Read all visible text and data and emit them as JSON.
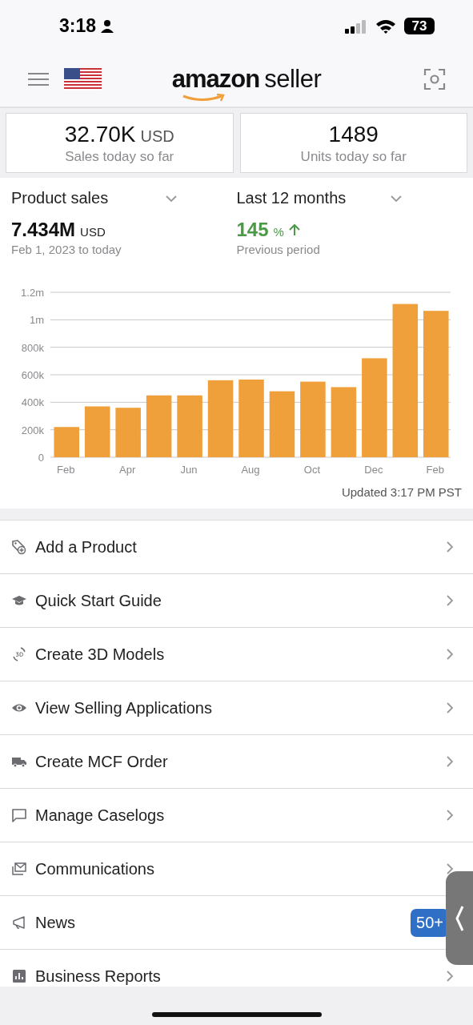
{
  "status_bar": {
    "time": "3:18",
    "battery": "73"
  },
  "header": {
    "logo": {
      "brand": "amazon",
      "product": "seller"
    }
  },
  "stats": [
    {
      "value": "32.70K",
      "unit": "USD",
      "label": "Sales today so far"
    },
    {
      "value": "1489",
      "label": "Units today so far"
    }
  ],
  "selectors": [
    {
      "label": "Product sales"
    },
    {
      "label": "Last 12 months"
    }
  ],
  "total": {
    "value": "7.434M",
    "unit": "USD",
    "caption": "Feb 1, 2023 to today"
  },
  "change": {
    "value": "145",
    "unit": "%",
    "caption": "Previous period"
  },
  "chart_data": {
    "type": "bar",
    "grid": true,
    "categories": [
      "Feb",
      null,
      "Apr",
      null,
      "Jun",
      null,
      "Aug",
      null,
      "Oct",
      null,
      "Dec",
      null,
      "Feb"
    ],
    "series": [
      {
        "color": "#f0a03a",
        "values": [
          220000,
          370000,
          360000,
          450000,
          450000,
          560000,
          565000,
          480000,
          550000,
          510000,
          720000,
          1115000,
          1065000
        ]
      }
    ],
    "ylim": [
      0,
      1200000
    ],
    "yticks": [
      {
        "value": 0,
        "label": "0"
      },
      {
        "value": 200000,
        "label": "200k"
      },
      {
        "value": 400000,
        "label": "400k"
      },
      {
        "value": 600000,
        "label": "600k"
      },
      {
        "value": 800000,
        "label": "800k"
      },
      {
        "value": 1000000,
        "label": "1m"
      },
      {
        "value": 1200000,
        "label": "1.2m"
      }
    ]
  },
  "updated": "Updated 3:17 PM PST",
  "menu": [
    {
      "label": "Add a Product"
    },
    {
      "label": "Quick Start Guide"
    },
    {
      "label": "Create 3D Models"
    },
    {
      "label": "View Selling Applications"
    },
    {
      "label": "Create MCF Order"
    },
    {
      "label": "Manage Caselogs"
    },
    {
      "label": "Communications"
    },
    {
      "label": "News",
      "badge": "50+"
    },
    {
      "label": "Business Reports"
    }
  ]
}
